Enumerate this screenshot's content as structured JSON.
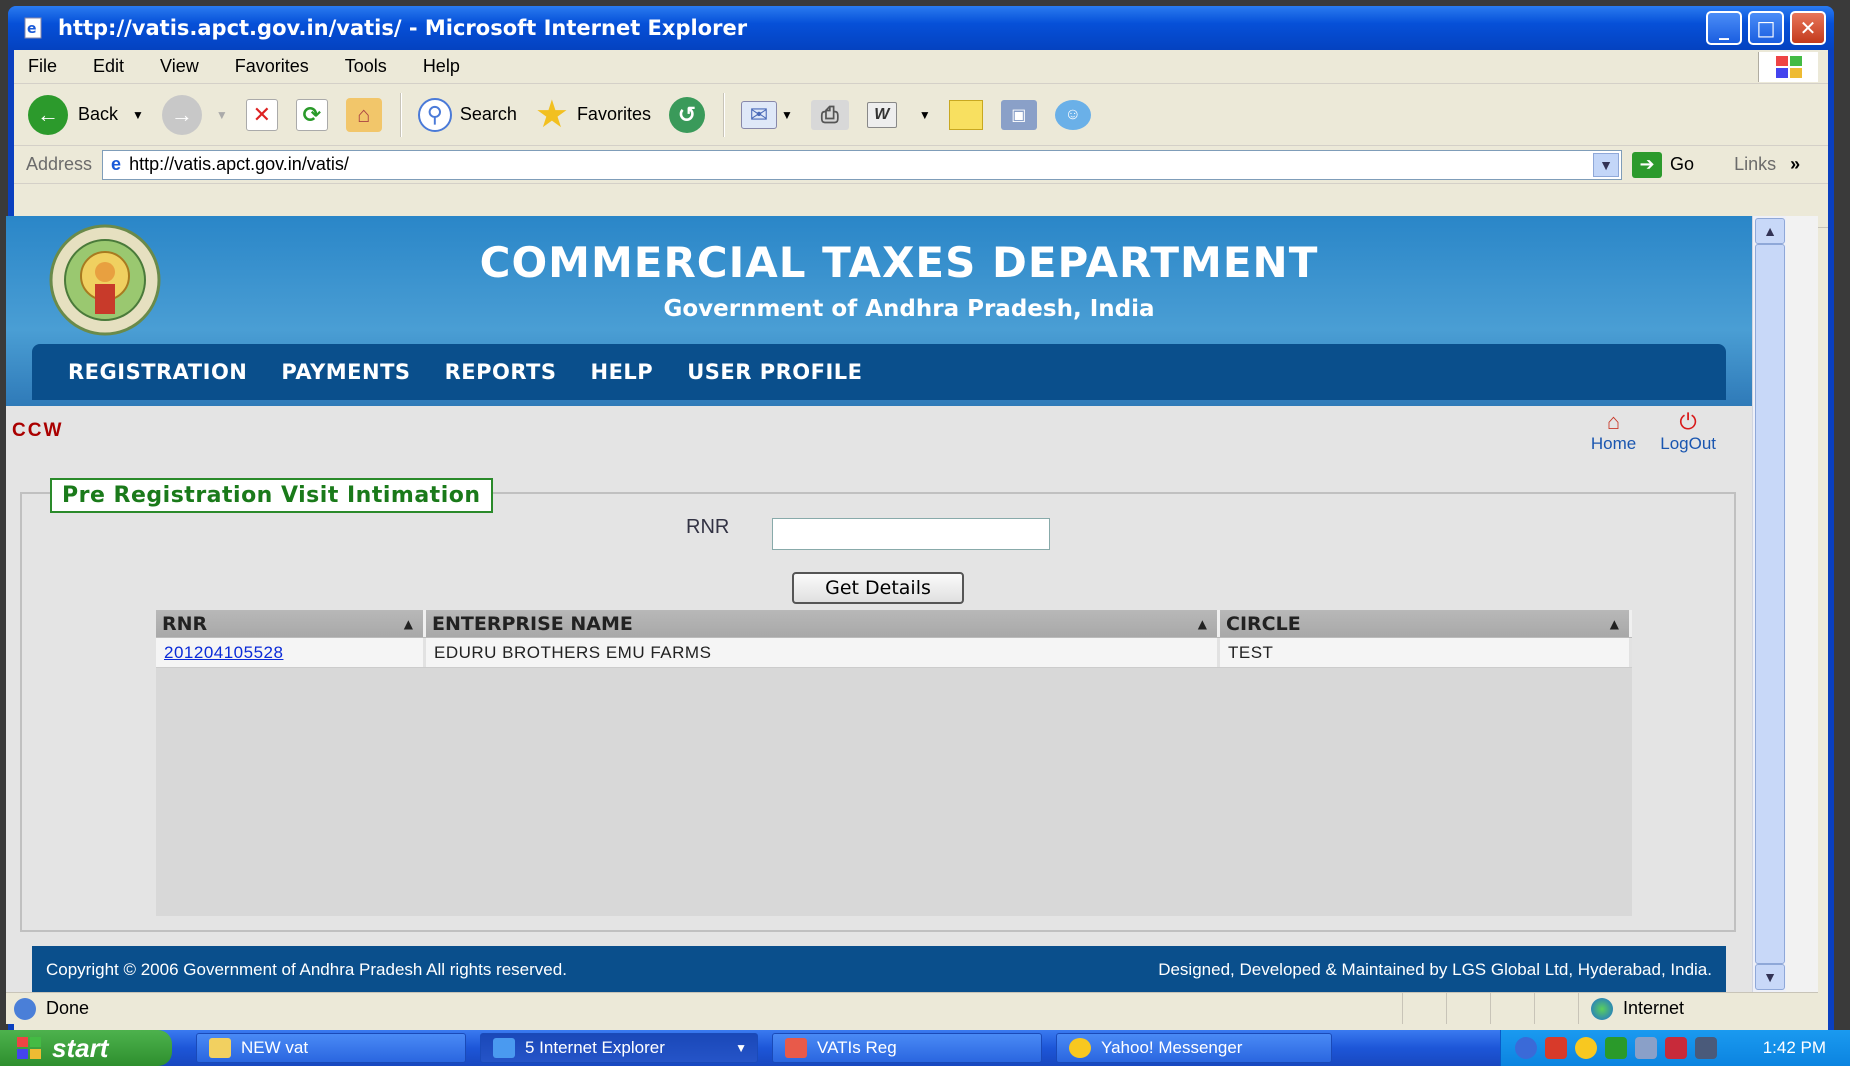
{
  "window": {
    "title": "http://vatis.apct.gov.in/vatis/ - Microsoft Internet Explorer",
    "minimize": "_",
    "maximize": "□",
    "close": "✕"
  },
  "menu": [
    "File",
    "Edit",
    "View",
    "Favorites",
    "Tools",
    "Help"
  ],
  "toolbar": {
    "back_label": "Back",
    "search_label": "Search",
    "favorites_label": "Favorites"
  },
  "address": {
    "label": "Address",
    "url": "http://vatis.apct.gov.in/vatis/",
    "go_label": "Go",
    "links_label": "Links",
    "links_chevron": "»"
  },
  "site": {
    "title": "COMMERCIAL TAXES DEPARTMENT",
    "subtitle": "Government of Andhra Pradesh, India",
    "nav": [
      "REGISTRATION",
      "PAYMENTS",
      "REPORTS",
      "HELP",
      "USER PROFILE"
    ],
    "user_tag": "CCW",
    "home_label": "Home",
    "logout_label": "LogOut"
  },
  "form": {
    "legend": "Pre Registration Visit Intimation",
    "rnr_label": "RNR",
    "rnr_value": "",
    "button_label": "Get Details"
  },
  "grid": {
    "columns": [
      "RNR",
      "ENTERPRISE NAME",
      "CIRCLE"
    ],
    "rows": [
      {
        "rnr": "201204105528",
        "enterprise": "EDURU BROTHERS EMU FARMS",
        "circle": "TEST"
      }
    ]
  },
  "footer": {
    "left": "Copyright © 2006 Government of Andhra Pradesh All rights reserved.",
    "right": "Designed, Developed & Maintained by LGS Global Ltd, Hyderabad, India."
  },
  "status": {
    "text": "Done",
    "zone": "Internet"
  },
  "taskbar": {
    "start_label": "start",
    "tasks": [
      "NEW vat",
      "5 Internet Explorer",
      "VATIs Reg",
      "Yahoo! Messenger"
    ],
    "clock": "1:42 PM"
  },
  "colors": {
    "nav_blue": "#0a4f8c",
    "header_blue": "#2a86c8",
    "legend_green": "#1a7a1a",
    "user_tag_red": "#aa0000"
  }
}
